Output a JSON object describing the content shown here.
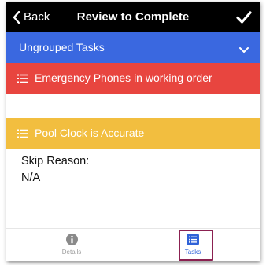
{
  "navbar": {
    "back_label": "Back",
    "title": "Review to Complete"
  },
  "group": {
    "label": "Ungrouped Tasks",
    "color": "#3a68e0"
  },
  "tasks": [
    {
      "label": "Emergency Phones in working order",
      "color": "#e8453f",
      "icon": "list-icon"
    },
    {
      "label": "Pool Clock is Accurate",
      "color": "#f2be3f",
      "icon": "list-icon"
    }
  ],
  "skip": {
    "label": "Skip Reason:",
    "value": "N/A"
  },
  "tabbar": {
    "items": [
      {
        "label": "Details",
        "icon": "info-icon",
        "active": false
      },
      {
        "label": "Tasks",
        "icon": "list-icon",
        "active": true
      }
    ]
  },
  "colors": {
    "navbar": "#000000",
    "active_tab": "#2f62d8",
    "highlight": "#8b2151"
  }
}
